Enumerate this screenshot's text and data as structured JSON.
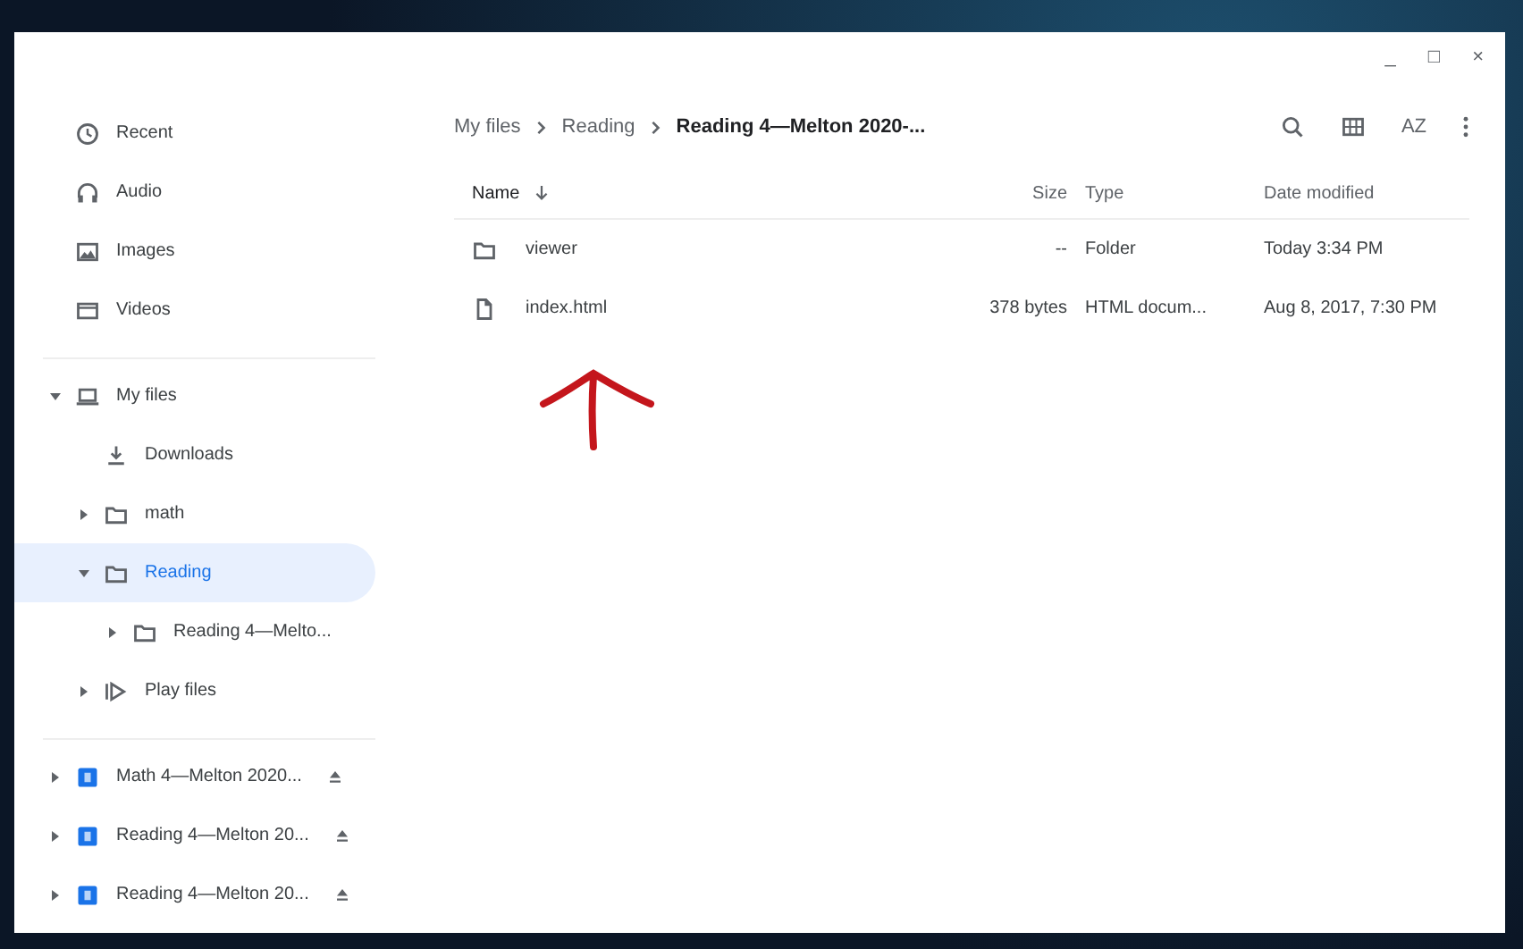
{
  "window_controls": [
    "_",
    "□",
    "×"
  ],
  "sidebar": {
    "shortcuts": [
      {
        "kind": "clock",
        "label": "Recent",
        "selected": false
      },
      {
        "kind": "headphones",
        "label": "Audio",
        "selected": false
      },
      {
        "kind": "image",
        "label": "Images",
        "selected": false
      },
      {
        "kind": "video",
        "label": "Videos",
        "selected": false
      }
    ],
    "tree": [
      {
        "kind": "laptop",
        "label": "My files",
        "selected": false,
        "expanded": true,
        "children": [
          {
            "kind": "download",
            "label": "Downloads",
            "selected": false
          },
          {
            "kind": "folder",
            "label": "math",
            "selected": false,
            "expanded": false
          },
          {
            "kind": "folder",
            "label": "Reading",
            "selected": true,
            "expanded": true,
            "children": [
              {
                "kind": "folder",
                "label": "Reading 4—Melto...",
                "selected": false,
                "expanded": false
              }
            ]
          },
          {
            "kind": "play",
            "label": "Play files",
            "selected": false,
            "expanded": false
          }
        ]
      }
    ],
    "drives": [
      {
        "kind": "drive",
        "label": "Math 4—Melton 2020...",
        "selected": false,
        "expanded": false
      },
      {
        "kind": "drive",
        "label": "Reading 4—Melton 20...",
        "selected": false,
        "expanded": false
      },
      {
        "kind": "drive",
        "label": "Reading 4—Melton 20...",
        "selected": false,
        "expanded": false
      }
    ]
  },
  "breadcrumb": [
    "My files",
    "Reading",
    "Reading 4—Melton 2020-..."
  ],
  "toolbar": {
    "sort_label": "AZ"
  },
  "table": {
    "columns": [
      {
        "label": "Name",
        "sorted": true
      },
      {
        "label": "Size",
        "sorted": false
      },
      {
        "label": "Type",
        "sorted": false
      },
      {
        "label": "Date modified",
        "sorted": false
      }
    ],
    "rows": [
      {
        "kind": "folder",
        "name": "viewer",
        "size": "--",
        "type": "Folder",
        "date": "Today 3:34 PM"
      },
      {
        "kind": "file",
        "name": "index.html",
        "size": "378 bytes",
        "type": "HTML docum...",
        "date": "Aug 8, 2017, 7:30 PM"
      }
    ]
  }
}
